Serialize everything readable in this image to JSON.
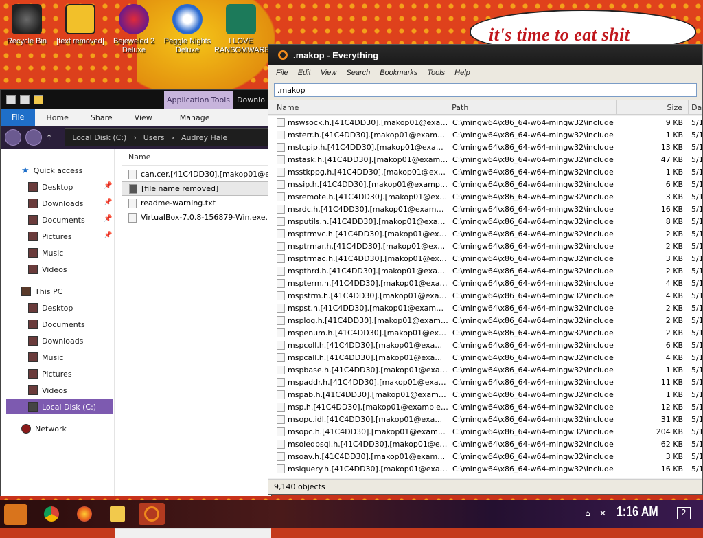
{
  "desktop": {
    "banner_text": "it's time to eat shit",
    "icons": [
      {
        "label": "Recycle Bin",
        "icon": "recycle-bin-icon"
      },
      {
        "label": "[text removed]",
        "icon": "app-icon"
      },
      {
        "label": "Bejeweled 2 Deluxe",
        "icon": "game-icon"
      },
      {
        "label": "Peggle Nights Deluxe",
        "icon": "game-icon"
      },
      {
        "label": "I LOVE RANSOMWARE",
        "icon": "publisher-icon"
      }
    ]
  },
  "explorer": {
    "tabs": {
      "app_tools": "Application Tools",
      "download": "Downlo",
      "file": "File",
      "home": "Home",
      "share": "Share",
      "view": "View",
      "manage": "Manage"
    },
    "breadcrumb": [
      "Local Disk (C:)",
      "Users",
      "Audrey Hale"
    ],
    "nav": {
      "quick_access": "Quick access",
      "qa_items": [
        "Desktop",
        "Downloads",
        "Documents",
        "Pictures",
        "Music",
        "Videos"
      ],
      "this_pc": "This PC",
      "pc_items": [
        "Desktop",
        "Documents",
        "Downloads",
        "Music",
        "Pictures",
        "Videos"
      ],
      "local_disk": "Local Disk (C:)",
      "network": "Network"
    },
    "column_name": "Name",
    "files": [
      "can.cer.[41C4DD30].[makop01@exam",
      "[file name removed]",
      "readme-warning.txt",
      "VirtualBox-7.0.8-156879-Win.exe.[41C"
    ]
  },
  "everything": {
    "title": ".makop - Everything",
    "menu": [
      "File",
      "Edit",
      "View",
      "Search",
      "Bookmarks",
      "Tools",
      "Help"
    ],
    "search_value": ".makop",
    "columns": {
      "name": "Name",
      "path": "Path",
      "size": "Size",
      "date": "Da"
    },
    "rows": [
      {
        "name": "mswsock.h.[41C4DD30].[makop01@example....",
        "path": "C:\\mingw64\\x86_64-w64-mingw32\\include",
        "size": "9 KB",
        "date": "5/1"
      },
      {
        "name": "msterr.h.[41C4DD30].[makop01@example.co...",
        "path": "C:\\mingw64\\x86_64-w64-mingw32\\include",
        "size": "1 KB",
        "date": "5/1"
      },
      {
        "name": "mstcpip.h.[41C4DD30].[makop01@example.c...",
        "path": "C:\\mingw64\\x86_64-w64-mingw32\\include",
        "size": "13 KB",
        "date": "5/1"
      },
      {
        "name": "mstask.h.[41C4DD30].[makop01@example.c...",
        "path": "C:\\mingw64\\x86_64-w64-mingw32\\include",
        "size": "47 KB",
        "date": "5/1"
      },
      {
        "name": "msstkppg.h.[41C4DD30].[makop01@example....",
        "path": "C:\\mingw64\\x86_64-w64-mingw32\\include",
        "size": "1 KB",
        "date": "5/1"
      },
      {
        "name": "mssip.h.[41C4DD30].[makop01@example.co...",
        "path": "C:\\mingw64\\x86_64-w64-mingw32\\include",
        "size": "6 KB",
        "date": "5/1"
      },
      {
        "name": "msremote.h.[41C4DD30].[makop01@exampl...",
        "path": "C:\\mingw64\\x86_64-w64-mingw32\\include",
        "size": "3 KB",
        "date": "5/1"
      },
      {
        "name": "msrdc.h.[41C4DD30].[makop01@example.co...",
        "path": "C:\\mingw64\\x86_64-w64-mingw32\\include",
        "size": "16 KB",
        "date": "5/1"
      },
      {
        "name": "msputils.h.[41C4DD30].[makop01@example....",
        "path": "C:\\mingw64\\x86_64-w64-mingw32\\include",
        "size": "8 KB",
        "date": "5/1"
      },
      {
        "name": "msptrmvc.h.[41C4DD30].[makop01@example....",
        "path": "C:\\mingw64\\x86_64-w64-mingw32\\include",
        "size": "2 KB",
        "date": "5/1"
      },
      {
        "name": "msptrmar.h.[41C4DD30].[makop01@example....",
        "path": "C:\\mingw64\\x86_64-w64-mingw32\\include",
        "size": "2 KB",
        "date": "5/1"
      },
      {
        "name": "msptrmac.h.[41C4DD30].[makop01@example....",
        "path": "C:\\mingw64\\x86_64-w64-mingw32\\include",
        "size": "3 KB",
        "date": "5/1"
      },
      {
        "name": "mspthrd.h.[41C4DD30].[makop01@example....",
        "path": "C:\\mingw64\\x86_64-w64-mingw32\\include",
        "size": "2 KB",
        "date": "5/1"
      },
      {
        "name": "mspterm.h.[41C4DD30].[makop01@example....",
        "path": "C:\\mingw64\\x86_64-w64-mingw32\\include",
        "size": "4 KB",
        "date": "5/1"
      },
      {
        "name": "mspstrm.h.[41C4DD30].[makop01@example....",
        "path": "C:\\mingw64\\x86_64-w64-mingw32\\include",
        "size": "4 KB",
        "date": "5/1"
      },
      {
        "name": "mspst.h.[41C4DD30].[makop01@example.co...",
        "path": "C:\\mingw64\\x86_64-w64-mingw32\\include",
        "size": "2 KB",
        "date": "5/1"
      },
      {
        "name": "msplog.h.[41C4DD30].[makop01@example.c...",
        "path": "C:\\mingw64\\x86_64-w64-mingw32\\include",
        "size": "2 KB",
        "date": "5/1"
      },
      {
        "name": "mspenum.h.[41C4DD30].[makop01@example....",
        "path": "C:\\mingw64\\x86_64-w64-mingw32\\include",
        "size": "2 KB",
        "date": "5/1"
      },
      {
        "name": "mspcoll.h.[41C4DD30].[makop01@example.c...",
        "path": "C:\\mingw64\\x86_64-w64-mingw32\\include",
        "size": "6 KB",
        "date": "5/1"
      },
      {
        "name": "mspcall.h.[41C4DD30].[makop01@example.c...",
        "path": "C:\\mingw64\\x86_64-w64-mingw32\\include",
        "size": "4 KB",
        "date": "5/1"
      },
      {
        "name": "mspbase.h.[41C4DD30].[makop01@example....",
        "path": "C:\\mingw64\\x86_64-w64-mingw32\\include",
        "size": "1 KB",
        "date": "5/1"
      },
      {
        "name": "mspaddr.h.[41C4DD30].[makop01@example....",
        "path": "C:\\mingw64\\x86_64-w64-mingw32\\include",
        "size": "11 KB",
        "date": "5/1"
      },
      {
        "name": "mspab.h.[41C4DD30].[makop01@example.c...",
        "path": "C:\\mingw64\\x86_64-w64-mingw32\\include",
        "size": "1 KB",
        "date": "5/1"
      },
      {
        "name": "msp.h.[41C4DD30].[makop01@example.com...",
        "path": "C:\\mingw64\\x86_64-w64-mingw32\\include",
        "size": "12 KB",
        "date": "5/1"
      },
      {
        "name": "msopc.idl.[41C4DD30].[makop01@example....",
        "path": "C:\\mingw64\\x86_64-w64-mingw32\\include",
        "size": "31 KB",
        "date": "5/1"
      },
      {
        "name": "msopc.h.[41C4DD30].[makop01@example.co...",
        "path": "C:\\mingw64\\x86_64-w64-mingw32\\include",
        "size": "204 KB",
        "date": "5/1"
      },
      {
        "name": "msoledbsql.h.[41C4DD30].[makop01@examp...",
        "path": "C:\\mingw64\\x86_64-w64-mingw32\\include",
        "size": "62 KB",
        "date": "5/1"
      },
      {
        "name": "msoav.h.[41C4DD30].[makop01@example.c...",
        "path": "C:\\mingw64\\x86_64-w64-mingw32\\include",
        "size": "3 KB",
        "date": "5/1"
      },
      {
        "name": "msiquery.h.[41C4DD30].[makop01@example....",
        "path": "C:\\mingw64\\x86_64-w64-mingw32\\include",
        "size": "16 KB",
        "date": "5/1"
      }
    ],
    "status": "9,140 objects"
  },
  "taskbar": {
    "clock": "1:16 AM",
    "notification_count": "2",
    "apps": [
      "start-icon",
      "chrome-icon",
      "firefox-icon",
      "file-explorer-icon",
      "everything-search-icon"
    ]
  },
  "colors": {
    "accent_purple": "#7d5ab0",
    "file_tab_blue": "#1f6fc9",
    "everything_orange": "#f08a1c",
    "banner_red": "#c0161c"
  }
}
